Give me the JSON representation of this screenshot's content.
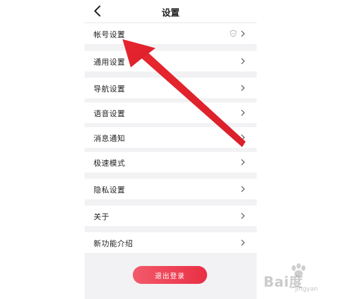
{
  "header": {
    "title": "设置"
  },
  "menu": {
    "items": [
      {
        "label": "帐号设置",
        "icon": "shield-icon"
      },
      {
        "label": "通用设置"
      },
      {
        "label": "导航设置"
      },
      {
        "label": "语音设置"
      },
      {
        "label": "消息通知"
      },
      {
        "label": "极速模式"
      },
      {
        "label": "隐私设置"
      },
      {
        "label": "关于"
      },
      {
        "label": "新功能介绍"
      }
    ]
  },
  "logout": {
    "label": "退出登录"
  },
  "colors": {
    "accent": "#ea2f44",
    "annotation_arrow": "#e1262f",
    "background": "#f2f2f4"
  },
  "watermark": {
    "brand": "Bai度",
    "sub": "jingyan"
  }
}
